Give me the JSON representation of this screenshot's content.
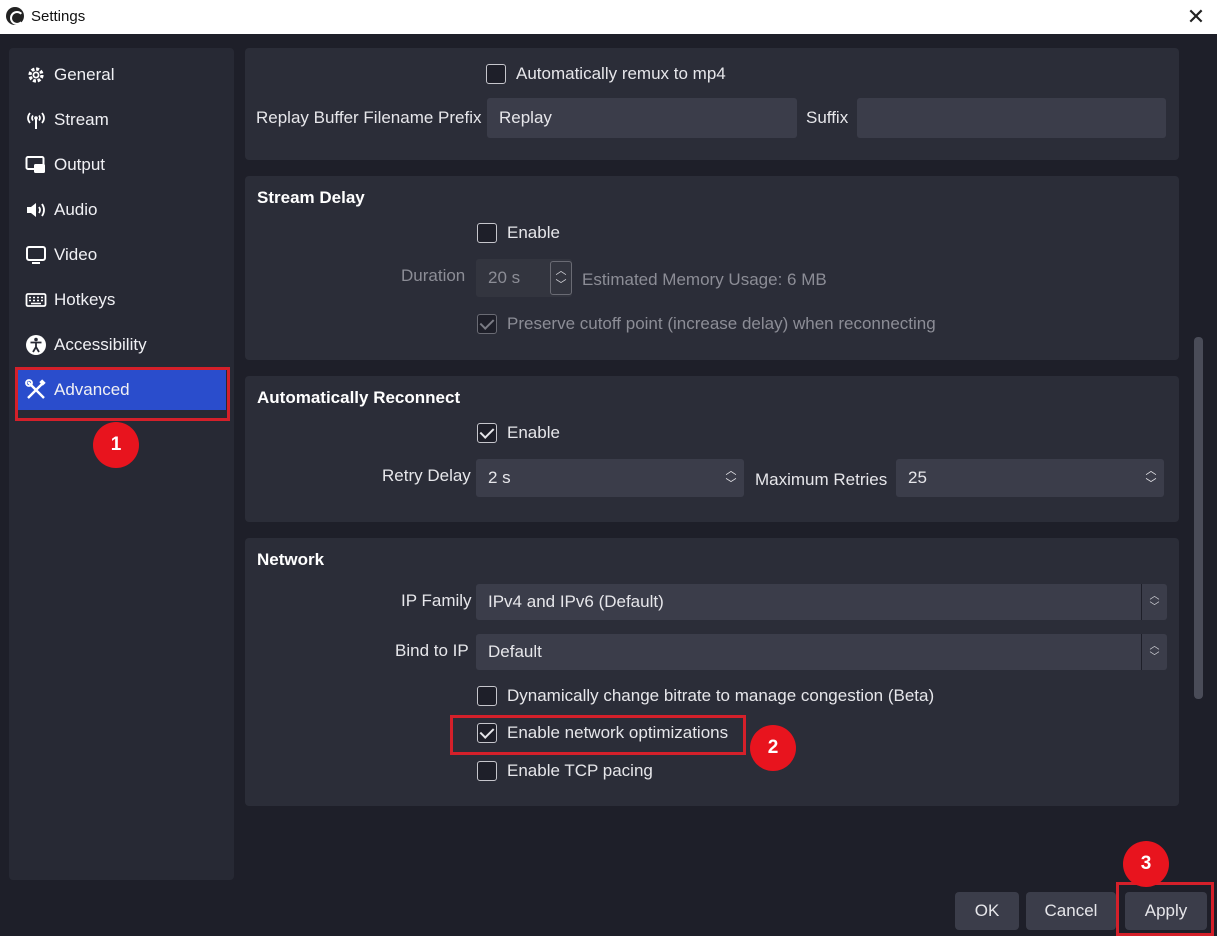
{
  "window": {
    "title": "Settings"
  },
  "sidebar": {
    "items": [
      {
        "label": "General",
        "icon": "gear-icon"
      },
      {
        "label": "Stream",
        "icon": "antenna-icon"
      },
      {
        "label": "Output",
        "icon": "output-icon"
      },
      {
        "label": "Audio",
        "icon": "speaker-icon"
      },
      {
        "label": "Video",
        "icon": "monitor-icon"
      },
      {
        "label": "Hotkeys",
        "icon": "keyboard-icon"
      },
      {
        "label": "Accessibility",
        "icon": "accessibility-icon"
      },
      {
        "label": "Advanced",
        "icon": "tools-icon",
        "active": true
      }
    ]
  },
  "replay": {
    "remux_label": "Automatically remux to mp4",
    "remux_checked": false,
    "prefix_label": "Replay Buffer Filename Prefix",
    "prefix_value": "Replay",
    "suffix_label": "Suffix",
    "suffix_value": ""
  },
  "stream_delay": {
    "title": "Stream Delay",
    "enable_label": "Enable",
    "enable_checked": false,
    "duration_label": "Duration",
    "duration_value": "20 s",
    "memory_text": "Estimated Memory Usage: 6 MB",
    "preserve_label": "Preserve cutoff point (increase delay) when reconnecting",
    "preserve_checked": true
  },
  "reconnect": {
    "title": "Automatically Reconnect",
    "enable_label": "Enable",
    "enable_checked": true,
    "retry_delay_label": "Retry Delay",
    "retry_delay_value": "2 s",
    "max_retries_label": "Maximum Retries",
    "max_retries_value": "25"
  },
  "network": {
    "title": "Network",
    "ip_family_label": "IP Family",
    "ip_family_value": "IPv4 and IPv6 (Default)",
    "bind_ip_label": "Bind to IP",
    "bind_ip_value": "Default",
    "dynamic_bitrate_label": "Dynamically change bitrate to manage congestion (Beta)",
    "dynamic_bitrate_checked": false,
    "net_opt_label": "Enable network optimizations",
    "net_opt_checked": true,
    "tcp_pacing_label": "Enable TCP pacing",
    "tcp_pacing_checked": false
  },
  "buttons": {
    "ok": "OK",
    "cancel": "Cancel",
    "apply": "Apply"
  },
  "annotations": {
    "step1": "1",
    "step2": "2",
    "step3": "3"
  },
  "colors": {
    "accent": "#2a4dcc",
    "highlight": "#d4202a",
    "badge": "#e8141e",
    "background": "#1e1f29",
    "panel": "#2b2d38"
  }
}
